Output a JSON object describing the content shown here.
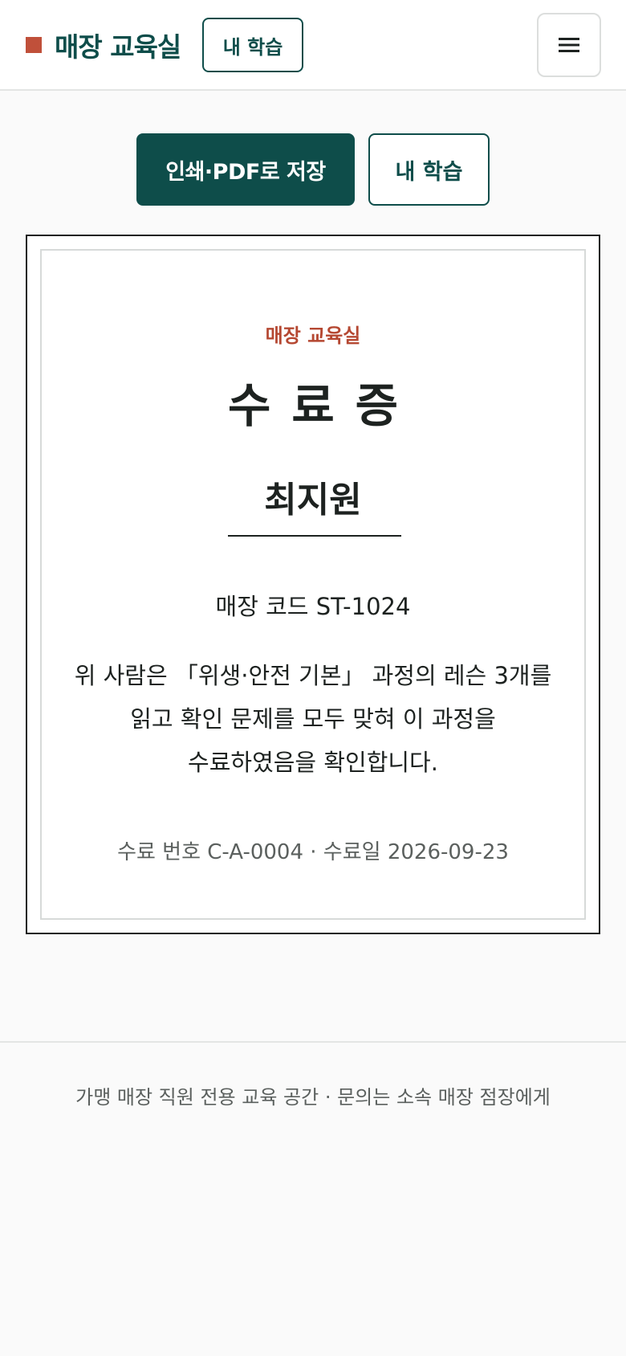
{
  "header": {
    "brand_name": "매장 교육실",
    "my_learning_label": "내 학습",
    "menu_icon": "hamburger-icon"
  },
  "actions": {
    "print_label": "인쇄·PDF로 저장",
    "my_learning_label": "내 학습"
  },
  "certificate": {
    "org": "매장 교육실",
    "title": "수료증",
    "recipient": "최지원",
    "store_code": "매장 코드 ST-1024",
    "body_line1": "위 사람은 「위생·안전 기본」 과정의 레슨 3개를",
    "body_line2": "읽고 확인 문제를 모두 맞혀 이 과정을",
    "body_line3": "수료하였음을 확인합니다.",
    "meta": "수료 번호 C-A-0004 · 수료일 2026-09-23"
  },
  "footer": {
    "text": "가맹 매장 직원 전용 교육 공간 · 문의는 소속 매장 점장에게"
  },
  "colors": {
    "brand": "#0e4d4a",
    "accent": "#c0503a"
  }
}
